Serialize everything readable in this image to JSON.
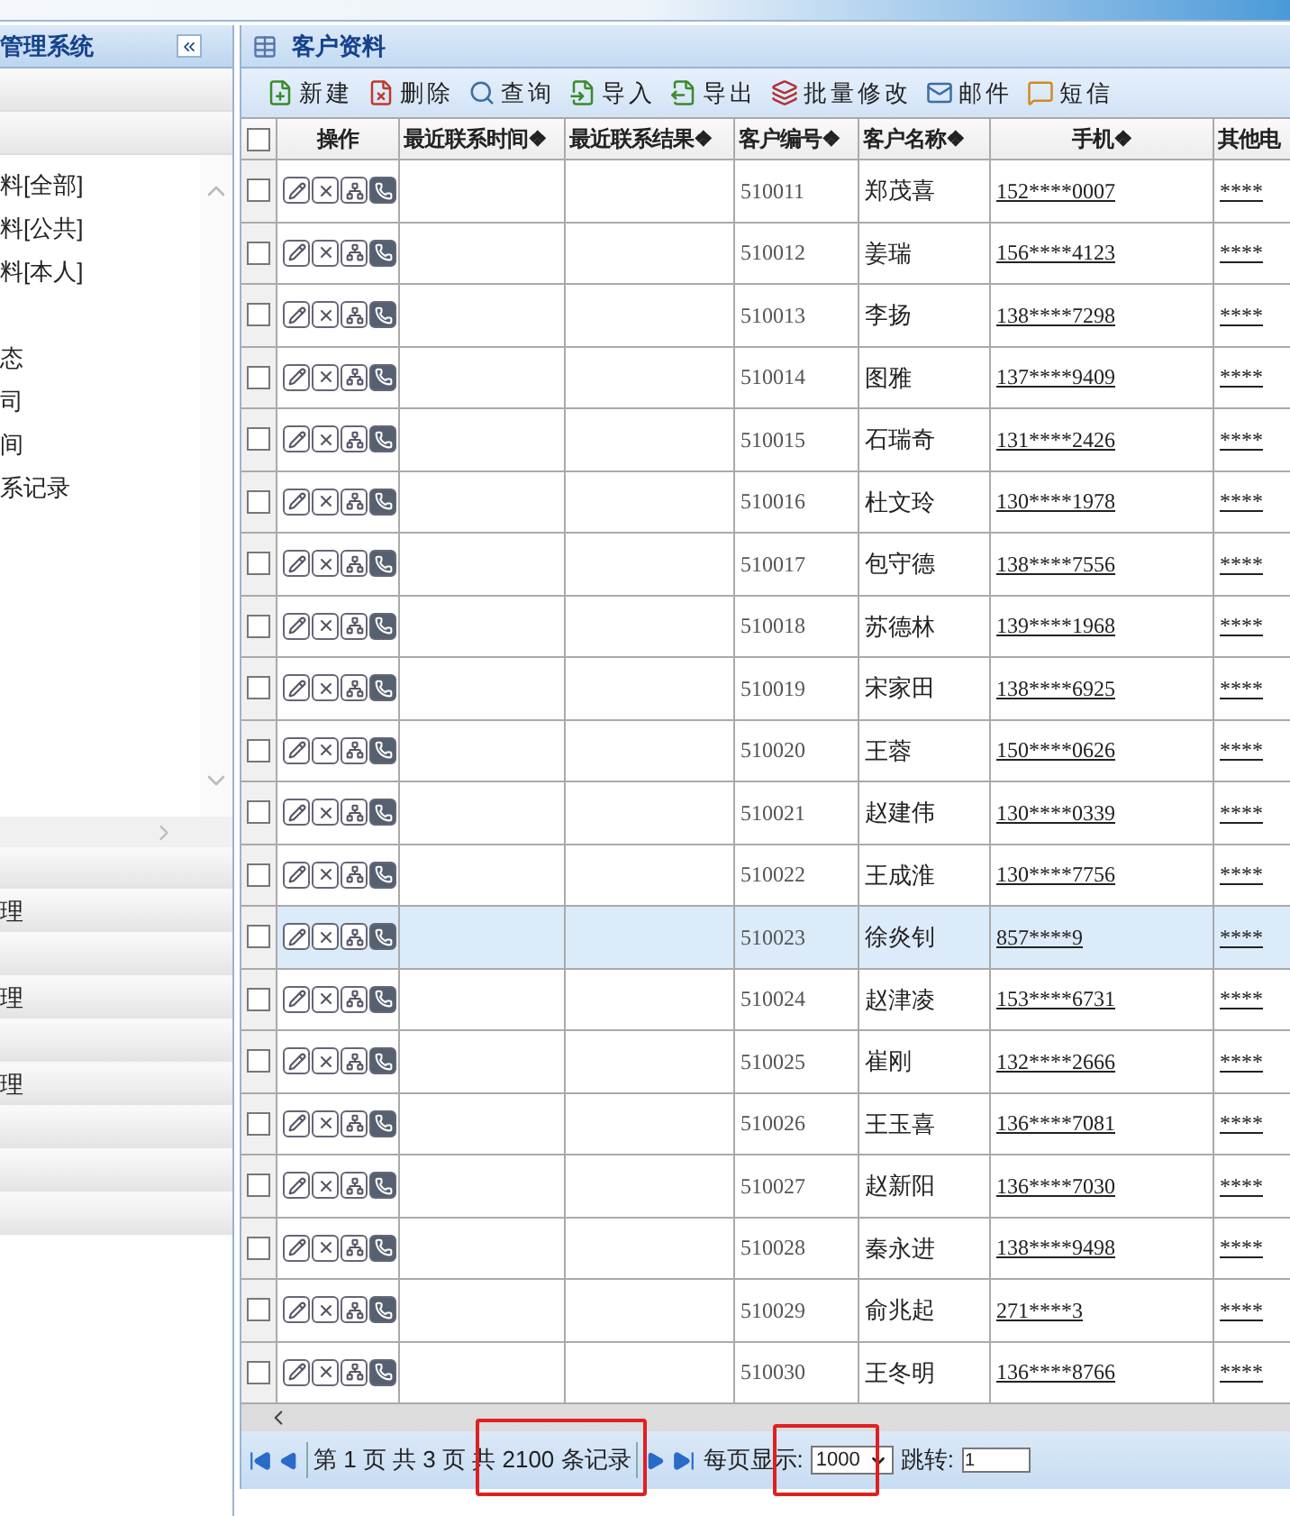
{
  "sidebar": {
    "title": "管理系统",
    "items": [
      {
        "kind": "text",
        "label": "料[全部]"
      },
      {
        "kind": "text",
        "label": "料[公共]"
      },
      {
        "kind": "text",
        "label": "料[本人]"
      },
      {
        "kind": "blank"
      },
      {
        "kind": "text",
        "label": "态"
      },
      {
        "kind": "text",
        "label": "司"
      },
      {
        "kind": "text",
        "label": "间"
      },
      {
        "kind": "text",
        "label": "系记录"
      }
    ],
    "sections": [
      {
        "kind": "blank"
      },
      {
        "kind": "text",
        "label": "理"
      },
      {
        "kind": "blank"
      },
      {
        "kind": "text",
        "label": "理"
      },
      {
        "kind": "blank"
      },
      {
        "kind": "text",
        "label": "理"
      },
      {
        "kind": "blank"
      },
      {
        "kind": "blank"
      },
      {
        "kind": "blank"
      }
    ]
  },
  "panel": {
    "title": "客户资料",
    "toolbar": [
      {
        "label": "新建",
        "kind": "new"
      },
      {
        "label": "删除",
        "kind": "delete"
      },
      {
        "label": "查询",
        "kind": "search"
      },
      {
        "label": "导入",
        "kind": "import"
      },
      {
        "label": "导出",
        "kind": "export"
      },
      {
        "label": "批量修改",
        "kind": "batch"
      },
      {
        "label": "邮件",
        "kind": "mail"
      },
      {
        "label": "短信",
        "kind": "sms"
      }
    ],
    "select_all_checked": false,
    "columns": [
      "操作",
      "最近联系时间❖",
      "最近联系结果❖",
      "客户编号❖",
      "客户名称❖",
      "手机❖",
      "其他电"
    ],
    "rows": [
      {
        "id": "510011",
        "name": "郑茂喜",
        "mobile": "152****0007",
        "other": "****",
        "selected": false,
        "checked": false
      },
      {
        "id": "510012",
        "name": "姜瑞",
        "mobile": "156****4123",
        "other": "****",
        "selected": false,
        "checked": false
      },
      {
        "id": "510013",
        "name": "李扬",
        "mobile": "138****7298",
        "other": "****",
        "selected": false,
        "checked": false
      },
      {
        "id": "510014",
        "name": "图雅",
        "mobile": "137****9409",
        "other": "****",
        "selected": false,
        "checked": false
      },
      {
        "id": "510015",
        "name": "石瑞奇",
        "mobile": "131****2426",
        "other": "****",
        "selected": false,
        "checked": false
      },
      {
        "id": "510016",
        "name": "杜文玲",
        "mobile": "130****1978",
        "other": "****",
        "selected": false,
        "checked": false
      },
      {
        "id": "510017",
        "name": "包守德",
        "mobile": "138****7556",
        "other": "****",
        "selected": false,
        "checked": false
      },
      {
        "id": "510018",
        "name": "苏德林",
        "mobile": "139****1968",
        "other": "****",
        "selected": false,
        "checked": false
      },
      {
        "id": "510019",
        "name": "宋家田",
        "mobile": "138****6925",
        "other": "****",
        "selected": false,
        "checked": false
      },
      {
        "id": "510020",
        "name": "王蓉",
        "mobile": "150****0626",
        "other": "****",
        "selected": false,
        "checked": false
      },
      {
        "id": "510021",
        "name": "赵建伟",
        "mobile": "130****0339",
        "other": "****",
        "selected": false,
        "checked": false
      },
      {
        "id": "510022",
        "name": "王成淮",
        "mobile": "130****7756",
        "other": "****",
        "selected": false,
        "checked": false
      },
      {
        "id": "510023",
        "name": "徐炎钊",
        "mobile": "857****9",
        "other": "****",
        "selected": true,
        "checked": false
      },
      {
        "id": "510024",
        "name": "赵津凌",
        "mobile": "153****6731",
        "other": "****",
        "selected": false,
        "checked": false
      },
      {
        "id": "510025",
        "name": "崔刚",
        "mobile": "132****2666",
        "other": "****",
        "selected": false,
        "checked": false
      },
      {
        "id": "510026",
        "name": "王玉喜",
        "mobile": "136****7081",
        "other": "****",
        "selected": false,
        "checked": false
      },
      {
        "id": "510027",
        "name": "赵新阳",
        "mobile": "136****7030",
        "other": "****",
        "selected": false,
        "checked": false
      },
      {
        "id": "510028",
        "name": "秦永进",
        "mobile": "138****9498",
        "other": "****",
        "selected": false,
        "checked": false
      },
      {
        "id": "510029",
        "name": "俞兆起",
        "mobile": "271****3",
        "other": "****",
        "selected": false,
        "checked": false
      },
      {
        "id": "510030",
        "name": "王冬明",
        "mobile": "136****8766",
        "other": "****",
        "selected": false,
        "checked": false
      }
    ],
    "pager": {
      "info": "第 1 页 共 3 页 共 2100 条记录",
      "page_size_label": "每页显示:",
      "page_size": "1000",
      "jump_label": "跳转:",
      "jump_value": "1"
    }
  }
}
